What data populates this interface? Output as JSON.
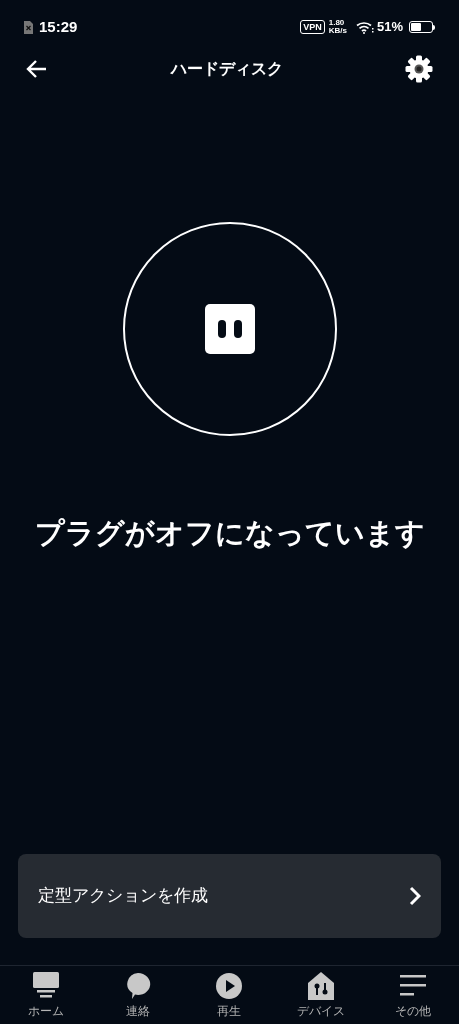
{
  "status_bar": {
    "time": "15:29",
    "vpn": "VPN",
    "speed_value": "1.80",
    "speed_unit": "KB/s",
    "battery_text": "51%"
  },
  "header": {
    "title": "ハードディスク"
  },
  "device": {
    "status_text": "プラグがオフになっています",
    "on": false
  },
  "action_card": {
    "label": "定型アクションを作成"
  },
  "nav": [
    {
      "kind": "home",
      "label": "ホーム"
    },
    {
      "kind": "chat",
      "label": "連絡"
    },
    {
      "kind": "play",
      "label": "再生"
    },
    {
      "kind": "devices",
      "label": "デバイス"
    },
    {
      "kind": "more",
      "label": "その他"
    }
  ]
}
